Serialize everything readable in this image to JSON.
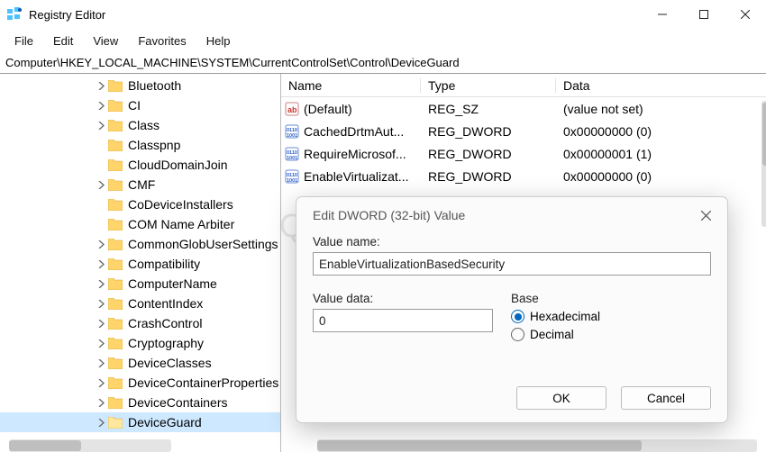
{
  "window": {
    "title": "Registry Editor"
  },
  "menu": [
    "File",
    "Edit",
    "View",
    "Favorites",
    "Help"
  ],
  "address": "Computer\\HKEY_LOCAL_MACHINE\\SYSTEM\\CurrentControlSet\\Control\\DeviceGuard",
  "tree": {
    "indent_base": 104,
    "items": [
      {
        "label": "Bluetooth",
        "exp": true
      },
      {
        "label": "CI",
        "exp": true
      },
      {
        "label": "Class",
        "exp": true
      },
      {
        "label": "Classpnp",
        "exp": false
      },
      {
        "label": "CloudDomainJoin",
        "exp": false
      },
      {
        "label": "CMF",
        "exp": true
      },
      {
        "label": "CoDeviceInstallers",
        "exp": false
      },
      {
        "label": "COM Name Arbiter",
        "exp": false
      },
      {
        "label": "CommonGlobUserSettings",
        "exp": true
      },
      {
        "label": "Compatibility",
        "exp": true
      },
      {
        "label": "ComputerName",
        "exp": true
      },
      {
        "label": "ContentIndex",
        "exp": true
      },
      {
        "label": "CrashControl",
        "exp": true
      },
      {
        "label": "Cryptography",
        "exp": true
      },
      {
        "label": "DeviceClasses",
        "exp": true
      },
      {
        "label": "DeviceContainerProperties",
        "exp": true
      },
      {
        "label": "DeviceContainers",
        "exp": true
      },
      {
        "label": "DeviceGuard",
        "exp": true,
        "selected": true
      }
    ]
  },
  "columns": [
    "Name",
    "Type",
    "Data"
  ],
  "values": [
    {
      "icon": "string",
      "name": "(Default)",
      "type": "REG_SZ",
      "data": "(value not set)"
    },
    {
      "icon": "dword",
      "name": "CachedDrtmAut...",
      "type": "REG_DWORD",
      "data": "0x00000000 (0)"
    },
    {
      "icon": "dword",
      "name": "RequireMicrosof...",
      "type": "REG_DWORD",
      "data": "0x00000001 (1)"
    },
    {
      "icon": "dword",
      "name": "EnableVirtualizat...",
      "type": "REG_DWORD",
      "data": "0x00000000 (0)"
    }
  ],
  "dialog": {
    "title": "Edit DWORD (32-bit) Value",
    "value_name_label": "Value name:",
    "value_name": "EnableVirtualizationBasedSecurity",
    "value_data_label": "Value data:",
    "value_data": "0",
    "base_label": "Base",
    "base_options": [
      "Hexadecimal",
      "Decimal"
    ],
    "base_selected": "Hexadecimal",
    "ok": "OK",
    "cancel": "Cancel"
  },
  "watermark": "Quantrimang"
}
